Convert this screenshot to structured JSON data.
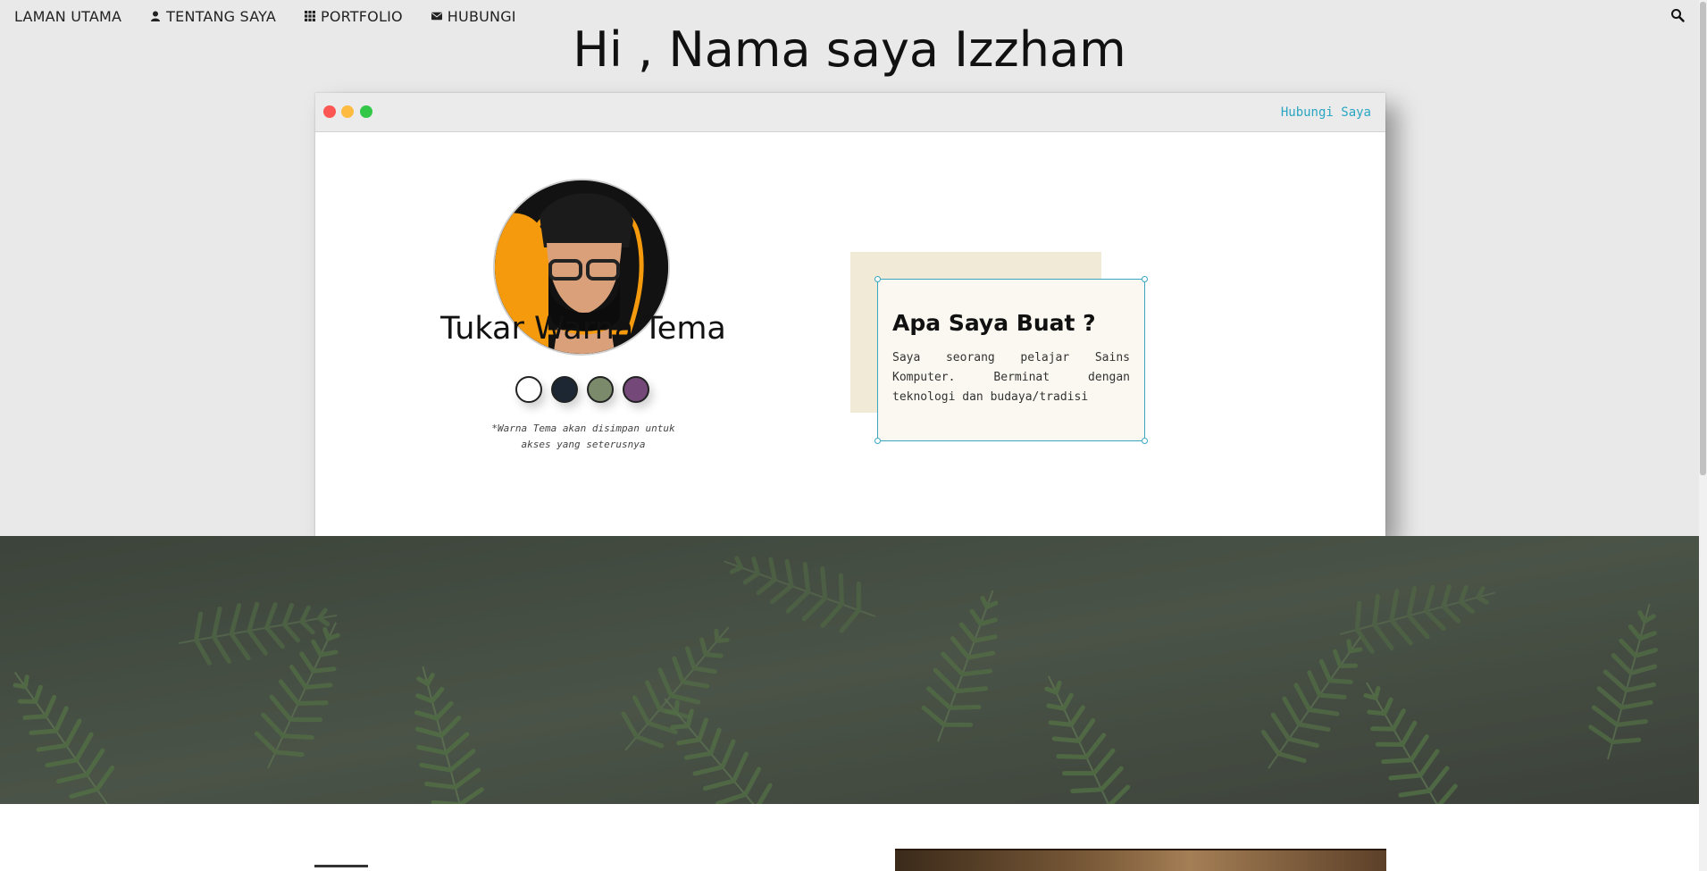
{
  "nav": {
    "items": [
      {
        "label": "LAMAN UTAMA",
        "icon": ""
      },
      {
        "label": "TENTANG SAYA",
        "icon": "user-icon"
      },
      {
        "label": "PORTFOLIO",
        "icon": "grid-icon"
      },
      {
        "label": "HUBUNGI",
        "icon": "envelope-icon"
      }
    ],
    "search_icon": "search-icon"
  },
  "hero": {
    "title": "Hi , Nama saya Izzham"
  },
  "window": {
    "link_label": "Hubungi Saya",
    "theme": {
      "title": "Tukar Warna Tema",
      "swatches": [
        "#ffffff",
        "#1c2733",
        "#7a8a6a",
        "#74497a"
      ],
      "note": "*Warna Tema akan disimpan untuk akses yang seterusnya"
    },
    "info": {
      "title": "Apa Saya Buat ?",
      "text": "Saya seorang pelajar Sains Komputer. Berminat dengan teknologi dan budaya/tradisi"
    }
  },
  "colors": {
    "accent": "#2aa6c2",
    "beige": "#f0ead6"
  }
}
